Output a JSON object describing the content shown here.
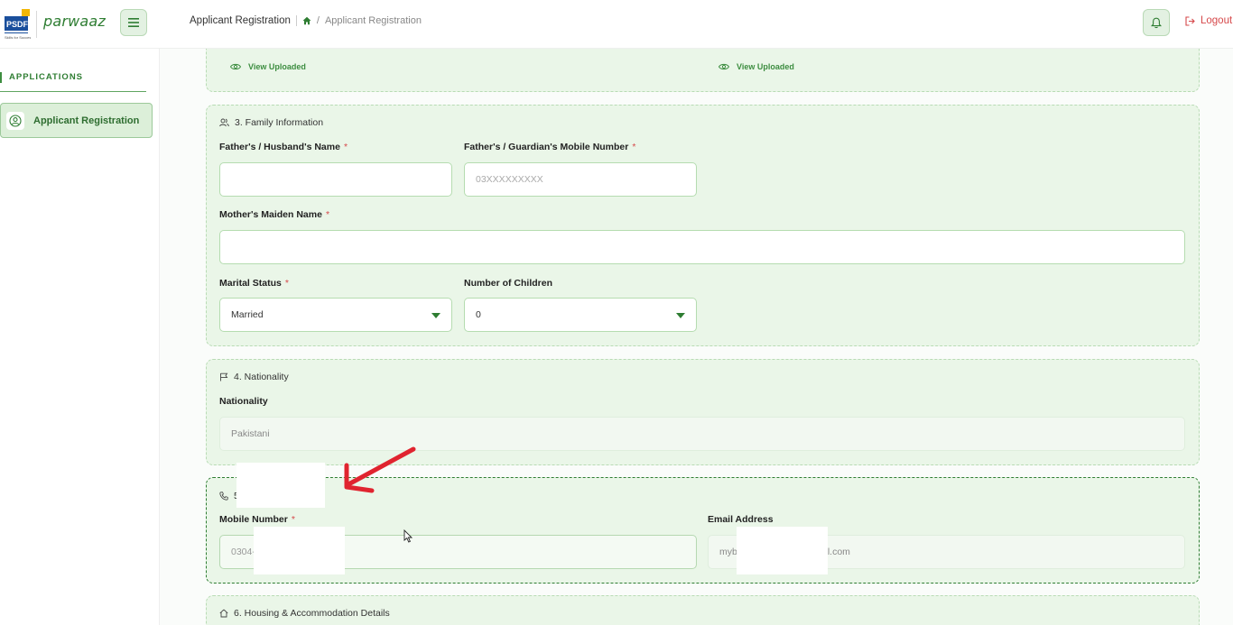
{
  "header": {
    "brand": "PSDF",
    "brand_sub": "Skills for Success",
    "app_name": "parwaaz",
    "page_title": "Applicant Registration",
    "breadcrumb_sep": "/",
    "breadcrumb_current": "Applicant Registration",
    "logout_label": "Logout"
  },
  "sidebar": {
    "heading": "APPLICATIONS",
    "items": [
      {
        "label": "Applicant Registration",
        "icon": "user-circle-icon",
        "active": true
      }
    ]
  },
  "uploads": {
    "view_label_1": "View Uploaded",
    "view_label_2": "View Uploaded"
  },
  "family": {
    "title": "3. Family Information",
    "father_label": "Father's / Husband's Name",
    "father_value": "",
    "guardian_mobile_label": "Father's / Guardian's Mobile Number",
    "guardian_mobile_placeholder": "03XXXXXXXXX",
    "mother_label": "Mother's Maiden Name",
    "mother_value": "",
    "marital_label": "Marital Status",
    "marital_value": "Married",
    "children_label": "Number of Children",
    "children_value": "0",
    "required_mark": "*"
  },
  "nationality": {
    "title": "4. Nationality",
    "label": "Nationality",
    "value": "Pakistani"
  },
  "contact": {
    "title_visible": "5",
    "mobile_label": "Mobile Number",
    "mobile_value_visible": "0304-",
    "email_label": "Email Address",
    "email_value_start": "myb",
    "email_value_end": "l.com"
  },
  "housing": {
    "title": "6. Housing & Accommodation Details"
  },
  "colors": {
    "accent": "#2e7d32",
    "section_bg": "#eaf6e8",
    "required": "#d6494b",
    "annotation_arrow": "#e0242f"
  }
}
